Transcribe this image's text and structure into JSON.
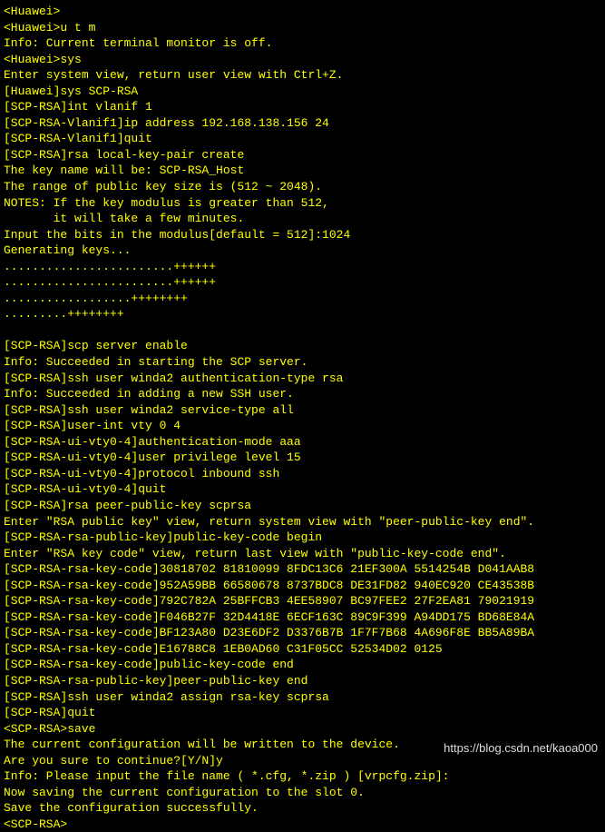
{
  "terminal": {
    "lines": [
      "<Huawei>",
      "<Huawei>u t m",
      "Info: Current terminal monitor is off.",
      "<Huawei>sys",
      "Enter system view, return user view with Ctrl+Z.",
      "[Huawei]sys SCP-RSA",
      "[SCP-RSA]int vlanif 1",
      "[SCP-RSA-Vlanif1]ip address 192.168.138.156 24",
      "[SCP-RSA-Vlanif1]quit",
      "[SCP-RSA]rsa local-key-pair create",
      "The key name will be: SCP-RSA_Host",
      "The range of public key size is (512 ~ 2048).",
      "NOTES: If the key modulus is greater than 512,",
      "       it will take a few minutes.",
      "Input the bits in the modulus[default = 512]:1024",
      "Generating keys...",
      "........................++++++",
      "........................++++++",
      "..................++++++++",
      ".........++++++++",
      "",
      "[SCP-RSA]scp server enable",
      "Info: Succeeded in starting the SCP server.",
      "[SCP-RSA]ssh user winda2 authentication-type rsa",
      "Info: Succeeded in adding a new SSH user.",
      "[SCP-RSA]ssh user winda2 service-type all",
      "[SCP-RSA]user-int vty 0 4",
      "[SCP-RSA-ui-vty0-4]authentication-mode aaa",
      "[SCP-RSA-ui-vty0-4]user privilege level 15",
      "[SCP-RSA-ui-vty0-4]protocol inbound ssh",
      "[SCP-RSA-ui-vty0-4]quit",
      "[SCP-RSA]rsa peer-public-key scprsa",
      "Enter \"RSA public key\" view, return system view with \"peer-public-key end\".",
      "[SCP-RSA-rsa-public-key]public-key-code begin",
      "Enter \"RSA key code\" view, return last view with \"public-key-code end\".",
      "[SCP-RSA-rsa-key-code]30818702 81810099 8FDC13C6 21EF300A 5514254B D041AAB8",
      "[SCP-RSA-rsa-key-code]952A59BB 66580678 8737BDC8 DE31FD82 940EC920 CE43538B",
      "[SCP-RSA-rsa-key-code]792C782A 25BFFCB3 4EE58907 BC97FEE2 27F2EA81 79021919",
      "[SCP-RSA-rsa-key-code]F046B27F 32D4418E 6ECF163C 89C9F399 A94DD175 BD68E84A",
      "[SCP-RSA-rsa-key-code]BF123A80 D23E6DF2 D3376B7B 1F7F7B68 4A696F8E BB5A89BA",
      "[SCP-RSA-rsa-key-code]E16788C8 1EB0AD60 C31F05CC 52534D02 0125",
      "[SCP-RSA-rsa-key-code]public-key-code end",
      "[SCP-RSA-rsa-public-key]peer-public-key end",
      "[SCP-RSA]ssh user winda2 assign rsa-key scprsa",
      "[SCP-RSA]quit",
      "<SCP-RSA>save",
      "The current configuration will be written to the device.",
      "Are you sure to continue?[Y/N]y",
      "Info: Please input the file name ( *.cfg, *.zip ) [vrpcfg.zip]:",
      "Now saving the current configuration to the slot 0.",
      "Save the configuration successfully.",
      "<SCP-RSA>"
    ]
  },
  "watermark": "https://blog.csdn.net/kaoa000"
}
